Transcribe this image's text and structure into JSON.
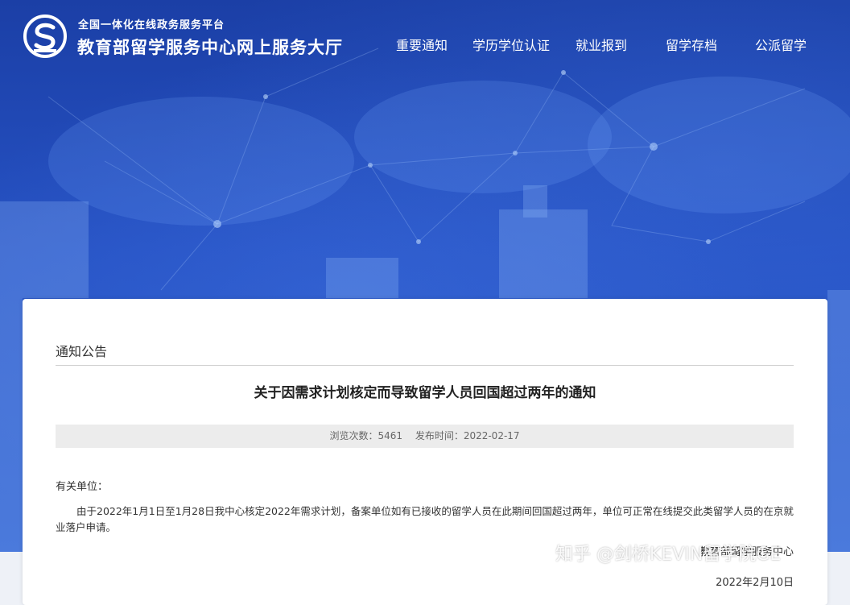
{
  "header": {
    "org_sub": "全国一体化在线政务服务平台",
    "org_main": "教育部留学服务中心网上服务大厅",
    "nav": [
      {
        "label": "重要通知"
      },
      {
        "label": "学历学位认证"
      },
      {
        "label": "就业报到"
      },
      {
        "label": "留学存档"
      },
      {
        "label": "公派留学"
      }
    ]
  },
  "article": {
    "breadcrumb": "通知公告",
    "title": "关于因需求计划核定而导致留学人员回国超过两年的通知",
    "views_label": "浏览次数：5461",
    "publish_label": "发布时间：2022-02-17",
    "salutation": "有关单位：",
    "body": "由于2022年1月1日至1月28日我中心核定2022年需求计划，备案单位如有已接收的留学人员在此期间回国超过两年，单位可正常在线提交此类留学人员的在京就业落户申请。",
    "signer": "教育部留学服务中心",
    "date": "2022年2月10日"
  },
  "watermark": "知乎 @剑桥KEVIN留学院GE",
  "colors": {
    "hero_top": "#1b3fa6",
    "hero_bottom": "#2f60d0",
    "card": "#ffffff",
    "meta_bar": "#ececec"
  }
}
